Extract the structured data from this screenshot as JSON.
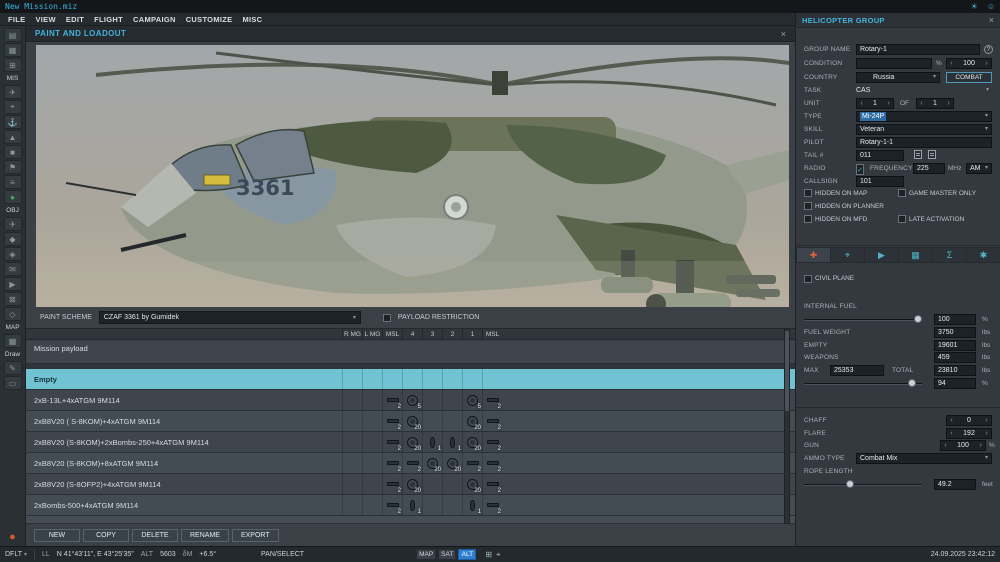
{
  "window": {
    "title": "New Mission.miz",
    "titlebar_icons": [
      {
        "name": "brightness-icon",
        "glyph": "☀"
      },
      {
        "name": "user-icon",
        "glyph": "☺"
      }
    ]
  },
  "menu": {
    "items": [
      "FILE",
      "VIEW",
      "EDIT",
      "FLIGHT",
      "CAMPAIGN",
      "CUSTOMIZE",
      "MISC"
    ]
  },
  "sidebar": {
    "items": [
      {
        "type": "icon",
        "name": "new-mission-icon",
        "glyph": "▤"
      },
      {
        "type": "icon",
        "name": "open-mission-icon",
        "glyph": "▦"
      },
      {
        "type": "icon",
        "name": "save-mission-icon",
        "glyph": "⊞"
      },
      {
        "type": "label",
        "text": "MIS"
      },
      {
        "type": "icon",
        "name": "aircraft-icon",
        "glyph": "✈"
      },
      {
        "type": "icon",
        "name": "helicopter-icon",
        "glyph": "⌖"
      },
      {
        "type": "icon",
        "name": "ship-icon",
        "glyph": "⚓"
      },
      {
        "type": "icon",
        "name": "vehicle-icon",
        "glyph": "▲"
      },
      {
        "type": "icon",
        "name": "static-object-icon",
        "glyph": "■"
      },
      {
        "type": "icon",
        "name": "flag-icon",
        "glyph": "⚑"
      },
      {
        "type": "icon",
        "name": "list-icon",
        "glyph": "≡"
      },
      {
        "type": "icon",
        "name": "trigger-zone-icon",
        "glyph": "●",
        "color": "#3fae6a"
      },
      {
        "type": "label",
        "text": "OBJ"
      },
      {
        "type": "icon",
        "name": "plane-group-icon",
        "glyph": "✈"
      },
      {
        "type": "icon",
        "name": "waypoint-icon",
        "glyph": "◆"
      },
      {
        "type": "icon",
        "name": "template-icon",
        "glyph": "◈"
      },
      {
        "type": "icon",
        "name": "message-icon",
        "glyph": "✉"
      },
      {
        "type": "icon",
        "name": "play-icon",
        "glyph": "▶"
      },
      {
        "type": "icon",
        "name": "erase-icon",
        "glyph": "⊠"
      },
      {
        "type": "icon",
        "name": "marker-icon",
        "glyph": "◇"
      },
      {
        "type": "label",
        "text": "MAP"
      },
      {
        "type": "icon",
        "name": "map-layers-icon",
        "glyph": "▦"
      },
      {
        "type": "label",
        "text": "Draw"
      },
      {
        "type": "icon",
        "name": "pencil-icon",
        "glyph": "✎"
      },
      {
        "type": "icon",
        "name": "shape-icon",
        "glyph": "▭"
      },
      {
        "type": "icon",
        "name": "record-icon",
        "glyph": "●",
        "color": "#d4582e",
        "push": true
      }
    ]
  },
  "paint_panel": {
    "title": "PAINT AND LOADOUT",
    "close_glyph": "×",
    "aircraft_number": "3361",
    "paint_scheme_label": "PAINT SCHEME",
    "paint_scheme_value": "CZAF 3361 by Gumidek",
    "payload_restriction_label": "PAYLOAD RESTRICTION",
    "columns": [
      "R MG",
      "L MG",
      "MSL",
      "4",
      "3",
      "2",
      "1",
      "MSL"
    ],
    "mission_payload_label": "Mission payload",
    "rows": [
      {
        "label": "Empty",
        "selected": true,
        "cells": []
      },
      {
        "label": "2xB-13L+4xATGM 9M114",
        "cells": [
          {
            "col": 2,
            "icon": "missile",
            "count": "2"
          },
          {
            "col": 3,
            "icon": "pod",
            "count": "5"
          },
          {
            "col": 6,
            "icon": "pod",
            "count": "5"
          },
          {
            "col": 7,
            "icon": "missile",
            "count": "2"
          }
        ]
      },
      {
        "label": "2xB8V20 ( S-8KOM)+4xATGM 9M114",
        "cells": [
          {
            "col": 2,
            "icon": "missile",
            "count": "2"
          },
          {
            "col": 3,
            "icon": "pod",
            "count": "20"
          },
          {
            "col": 6,
            "icon": "pod",
            "count": "20"
          },
          {
            "col": 7,
            "icon": "missile",
            "count": "2"
          }
        ]
      },
      {
        "label": "2xB8V20 (S-8KOM)+2xBombs-250+4xATGM 9M114",
        "cells": [
          {
            "col": 2,
            "icon": "missile",
            "count": "2"
          },
          {
            "col": 3,
            "icon": "pod",
            "count": "20"
          },
          {
            "col": 4,
            "icon": "bomb",
            "count": "1"
          },
          {
            "col": 5,
            "icon": "bomb",
            "count": "1"
          },
          {
            "col": 6,
            "icon": "pod",
            "count": "20"
          },
          {
            "col": 7,
            "icon": "missile",
            "count": "2"
          }
        ]
      },
      {
        "label": "2xB8V20 (S-8KOM)+8xATGM 9M114",
        "cells": [
          {
            "col": 2,
            "icon": "missile",
            "count": "2"
          },
          {
            "col": 3,
            "icon": "missile",
            "count": "2"
          },
          {
            "col": 4,
            "icon": "pod",
            "count": "20"
          },
          {
            "col": 5,
            "icon": "pod",
            "count": "20"
          },
          {
            "col": 6,
            "icon": "missile",
            "count": "2"
          },
          {
            "col": 7,
            "icon": "missile",
            "count": "2"
          }
        ]
      },
      {
        "label": "2xB8V20 (S-8OFP2)+4xATGM 9M114",
        "cells": [
          {
            "col": 2,
            "icon": "missile",
            "count": "2"
          },
          {
            "col": 3,
            "icon": "pod",
            "count": "20"
          },
          {
            "col": 6,
            "icon": "pod",
            "count": "20"
          },
          {
            "col": 7,
            "icon": "missile",
            "count": "2"
          }
        ]
      },
      {
        "label": "2xBombs-500+4xATGM 9M114",
        "cells": [
          {
            "col": 2,
            "icon": "missile",
            "count": "2"
          },
          {
            "col": 3,
            "icon": "bomb",
            "count": "1"
          },
          {
            "col": 6,
            "icon": "bomb",
            "count": "1"
          },
          {
            "col": 7,
            "icon": "missile",
            "count": "2"
          }
        ]
      }
    ],
    "buttons": [
      "NEW",
      "COPY",
      "DELETE",
      "RENAME",
      "EXPORT"
    ]
  },
  "group_panel": {
    "title": "HELICOPTER GROUP",
    "close_glyph": "×",
    "help_glyph": "?",
    "group_name": {
      "label": "GROUP NAME",
      "value": "Rotary-1"
    },
    "condition": {
      "label": "CONDITION",
      "unit": "%",
      "value": "100"
    },
    "country": {
      "label": "COUNTRY",
      "value": "Russia",
      "combat_label": "COMBAT"
    },
    "task": {
      "label": "TASK",
      "value": "CAS"
    },
    "unit": {
      "label": "UNIT",
      "count": "1",
      "of_label": "OF",
      "total": "1"
    },
    "type": {
      "label": "TYPE",
      "value": "Mi-24P"
    },
    "skill": {
      "label": "SKILL",
      "value": "Veteran"
    },
    "pilot": {
      "label": "PILOT",
      "value": "Rotary-1-1"
    },
    "tail_number": {
      "label": "TAIL #",
      "value": "011"
    },
    "radio": {
      "label": "RADIO",
      "checked_glyph": "✓",
      "frequency_label": "FREQUENCY",
      "frequency": "225",
      "unit": "MHz",
      "modulation": "AM"
    },
    "callsign": {
      "label": "CALLSIGN",
      "value": "101"
    },
    "checkboxes": [
      {
        "label": "HIDDEN ON MAP",
        "checked": false,
        "col": 0,
        "row": 0
      },
      {
        "label": "GAME MASTER ONLY",
        "checked": false,
        "col": 1,
        "row": 0
      },
      {
        "label": "HIDDEN ON PLANNER",
        "checked": false,
        "col": 0,
        "row": 1
      },
      {
        "label": "HIDDEN ON MFD",
        "checked": false,
        "col": 0,
        "row": 2
      },
      {
        "label": "LATE ACTIVATION",
        "checked": false,
        "col": 1,
        "row": 2
      }
    ],
    "tabs": [
      {
        "name": "paint-loadout-tab",
        "glyph": "✚",
        "color": "#e0653a",
        "active": true
      },
      {
        "name": "route-tab",
        "glyph": "⌖",
        "color": "#4fb6c8",
        "active": false
      },
      {
        "name": "payload-tab",
        "glyph": "▶",
        "color": "#4fb6c8",
        "active": false
      },
      {
        "name": "systems-tab",
        "glyph": "▦",
        "color": "#4fb6c8",
        "active": false
      },
      {
        "name": "summary-tab",
        "glyph": "Σ",
        "color": "#4fb6c8",
        "active": false
      },
      {
        "name": "options-tab",
        "glyph": "✱",
        "color": "#4fb6c8",
        "active": false
      }
    ],
    "civil_plane_label": "CIVIL PLANE",
    "fuel": {
      "internal_label": "INTERNAL FUEL",
      "internal_value": "100",
      "internal_unit": "%",
      "weight_label": "FUEL WEIGHT",
      "weight": "3750",
      "weight_unit": "lbs",
      "empty_label": "EMPTY",
      "empty": "19601",
      "empty_unit": "lbs",
      "weapons_label": "WEAPONS",
      "weapons": "459",
      "weapons_unit": "lbs",
      "max_label": "MAX",
      "max": "25353",
      "total_label": "TOTAL",
      "total": "23810",
      "total_unit": "lbs",
      "load_value": "94",
      "load_unit": "%"
    },
    "chaff": {
      "label": "CHAFF",
      "value": "0"
    },
    "flare": {
      "label": "FLARE",
      "value": "192"
    },
    "gun": {
      "label": "GUN",
      "value": "100",
      "unit": "%"
    },
    "ammo_type": {
      "label": "AMMO TYPE",
      "value": "Combat Mix"
    },
    "rope": {
      "label": "ROPE LENGTH",
      "value": "49.2",
      "unit": "feet"
    }
  },
  "status_bar": {
    "mode": "DFLT",
    "coord_type": "LL",
    "coordinates": "N 41°43'11\", E 43°25'35\"",
    "alt_label": "ALT",
    "alt_value": "5603",
    "mag_label": "δM",
    "mag_value": "+6.5°",
    "tool": "PAN/SELECT",
    "layer_buttons": [
      {
        "label": "MAP",
        "active": false
      },
      {
        "label": "SAT",
        "active": false
      },
      {
        "label": "ALT",
        "active": true
      }
    ],
    "status_icons": [
      {
        "name": "measure-icon",
        "glyph": "⊞"
      },
      {
        "name": "compass-icon",
        "glyph": "⌖"
      }
    ],
    "clock": "24.09.2025 23:42:12"
  }
}
